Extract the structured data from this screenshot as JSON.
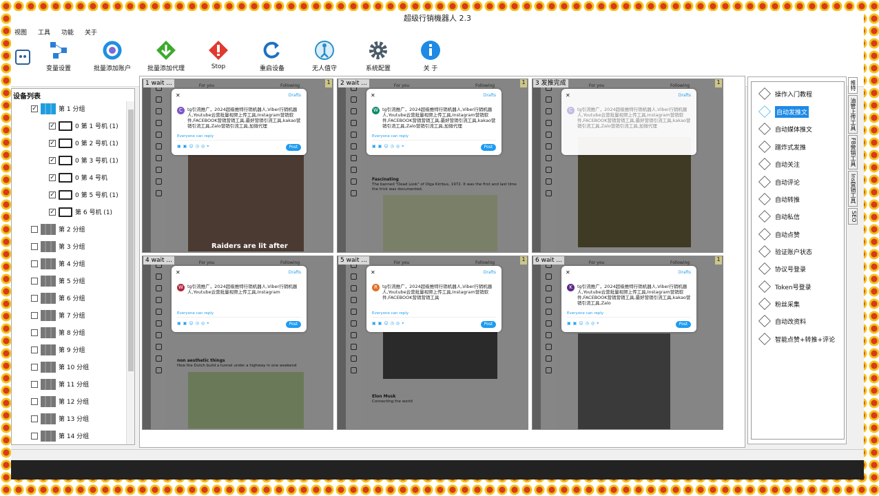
{
  "title": "超级行销機器人 2.3",
  "menu": [
    "视图",
    "工具",
    "功能",
    "关于"
  ],
  "toolbar": [
    {
      "label": "变量设置",
      "icon": "variables-icon",
      "color": "#2b7fd4"
    },
    {
      "label": "批量添加账户",
      "icon": "account-ring-icon",
      "color": "#1e90e0"
    },
    {
      "label": "批量添加代理",
      "icon": "download-arrow-icon",
      "color": "#3daa2e"
    },
    {
      "label": "Stop",
      "icon": "stop-warning-icon",
      "color": "#e03a30"
    },
    {
      "label": "重启设备",
      "icon": "restart-icon",
      "color": "#1e6fc4"
    },
    {
      "label": "无人值守",
      "icon": "unattended-person-icon",
      "color": "#2a8fc7"
    },
    {
      "label": "系统配置",
      "icon": "gear-icon",
      "color": "#4a5a68"
    },
    {
      "label": "关 于",
      "icon": "info-icon",
      "color": "#1e8ae6"
    }
  ],
  "device_list": {
    "title": "设备列表",
    "group1": "第 1 分组",
    "phones": [
      "0 第 1 号机 (1)",
      "0 第 2 号机 (1)",
      "0 第 3 号机 (1)",
      "0 第 4 号机",
      "0 第 5 号机 (1)",
      "第 6 号机 (1)"
    ],
    "groups": [
      "第 2 分组",
      "第 3 分组",
      "第 4 分组",
      "第 5 分组",
      "第 6 分组",
      "第 7 分组",
      "第 8 分组",
      "第 9 分组",
      "第 10 分组",
      "第 11 分组",
      "第 12 分组",
      "第 13 分组",
      "第 14 分组"
    ]
  },
  "panes": [
    {
      "num": "1",
      "status": "wait ...",
      "badge": "1",
      "avatar": "C",
      "avatar_color": "#7d55c7",
      "text": "tg引流推广，2024超级推特行销机器人,Viber行销机器人,Youtube云营批量视频上传工具,Instagram营销软件,FACEBOOK营销营销工具,最好营销引流工具,kakao营销引流工具,Zalo营销引流工具,加微代理",
      "caption": "Raiders are lit after"
    },
    {
      "num": "2",
      "status": "wait ...",
      "badge": "1",
      "avatar": "W",
      "avatar_color": "#0f8a6a",
      "text": "tg引流推广，2024超级推特行销机器人,Viber行销机器人,Youtube云营批量视频上传工具,Instagram营销软件,FACEBOOK营销营销工具,最好营销引流工具,kakao营销引流工具,Zalo营销引流工具,加微代理",
      "feed_user": "Fascinating",
      "feed_text": "The banned \"Dead Look\" of Olga Kirrbus, 1972. It was the first and last time the trick was documented."
    },
    {
      "num": "3",
      "status": "发推完成",
      "badge": "1",
      "avatar": "C",
      "avatar_color": "#c7c0e8",
      "text": "tg引流推广，2024超级推特行销机器人,Viber行销机器人,Youtube云营批量视频上传工具,Instagram营销软件,FACEBOOK营销营销工具,最好营销引流工具,kakao营销引流工具,Zalo营销引流工具,加微代理"
    },
    {
      "num": "4",
      "status": "wait ...",
      "badge": "1",
      "avatar": "W",
      "avatar_color": "#b0283c",
      "text": "tg引流推广，2024超级推特行销机器人,Viber行销机器人,Youtube云营批量视频上传工具,Instagram",
      "feed_user": "non aesthetic things",
      "feed_text": "How the Dutch build a tunnel under a highway in one weekend"
    },
    {
      "num": "5",
      "status": "wait ...",
      "badge": "1",
      "avatar": "R",
      "avatar_color": "#e0702a",
      "text": "tg引流推广，2024超级推特行销机器人,Viber行销机器人,Youtube云营批量视频上传工具,Instagram营销软件,FACEBOOK营销营销工具",
      "feed_user": "Elon Musk",
      "feed_text": "Connecting the world"
    },
    {
      "num": "6",
      "status": "wait ...",
      "badge": "1",
      "avatar": "K",
      "avatar_color": "#5b2a8a",
      "text": "tg引流推广，2024超级推特行销机器人,Viber行销机器人,Youtube云营批量视频上传工具,Instagram营销软件,FACEBOOK营销营销工具,最好营销引流工具,kakao营销引流工具,Zalo"
    }
  ],
  "compose": {
    "drafts": "Drafts",
    "reply": "Everyone can reply",
    "post": "Post",
    "for_you": "For you",
    "following": "Following"
  },
  "functions": [
    "操作入门教程",
    "自动发推文",
    "自动媒体推文",
    "蹭炸式发推",
    "自动关注",
    "自动评论",
    "自动转推",
    "自动私信",
    "自动点赞",
    "验证账户状态",
    "协议号登录",
    "Token号登录",
    "粉丝采集",
    "自动改资料",
    "智能点赞+转推+评论"
  ],
  "selected_function": 1,
  "vtabs": [
    "推特",
    "油管上传工具",
    "FB营销工具",
    "Ins营销工具",
    "SEO"
  ]
}
